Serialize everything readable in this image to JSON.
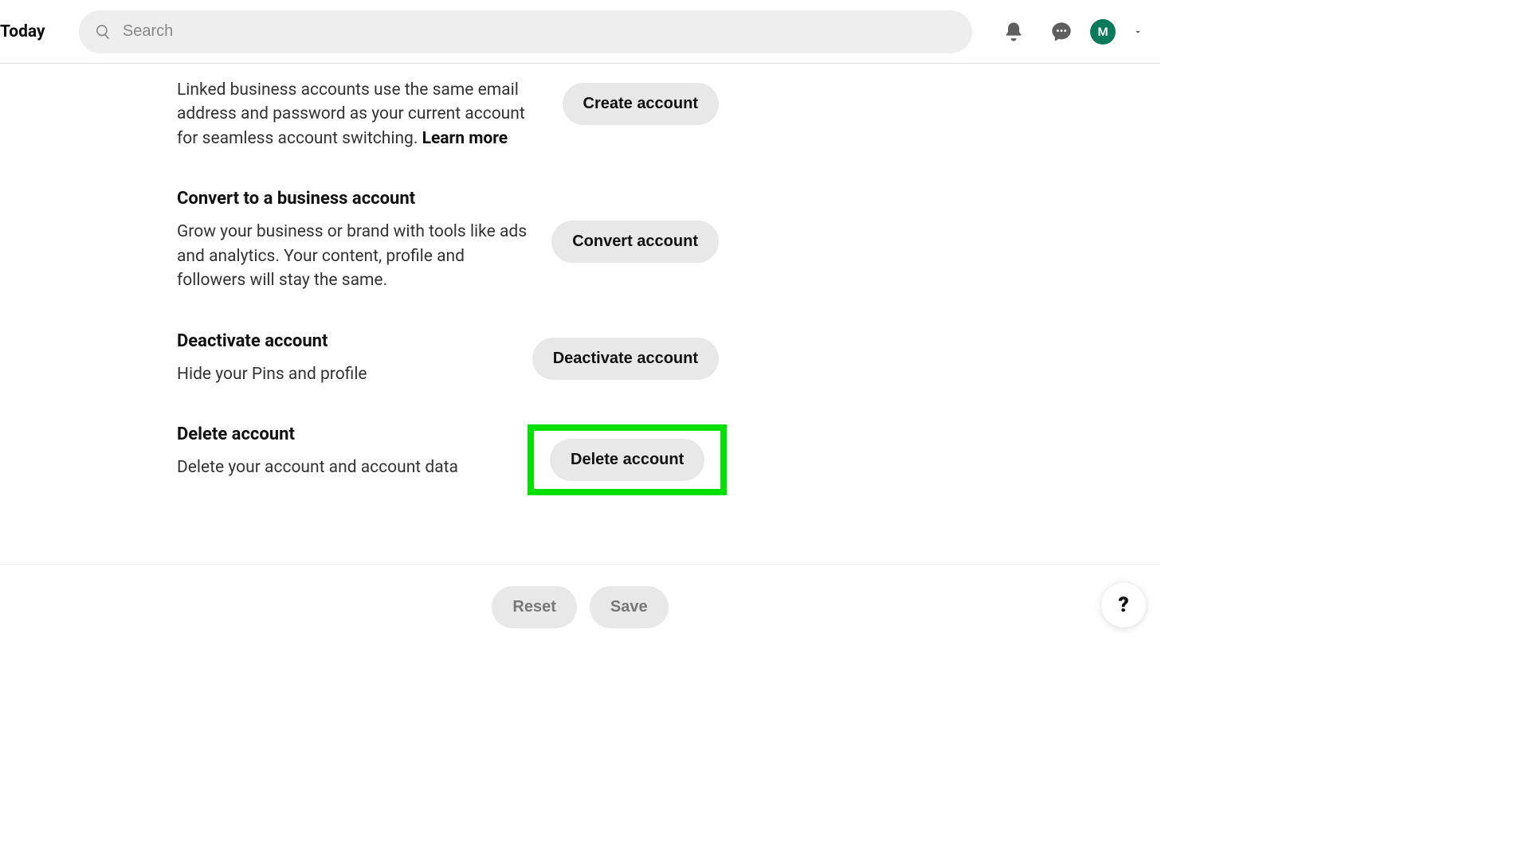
{
  "header": {
    "today": "Today",
    "search_placeholder": "Search",
    "avatar_letter": "M"
  },
  "sections": {
    "linked": {
      "desc_part1": "Linked business accounts use the same email address and password as your current account for seamless account switching. ",
      "learn_more": "Learn more",
      "button": "Create account"
    },
    "convert": {
      "title": "Convert to a business account",
      "desc": "Grow your business or brand with tools like ads and analytics. Your content, profile and followers will stay the same.",
      "button": "Convert account"
    },
    "deactivate": {
      "title": "Deactivate account",
      "desc": "Hide your Pins and profile",
      "button": "Deactivate account"
    },
    "delete": {
      "title": "Delete account",
      "desc": "Delete your account and account data",
      "button": "Delete account"
    }
  },
  "footer": {
    "reset": "Reset",
    "save": "Save"
  },
  "help": {
    "label": "?"
  }
}
